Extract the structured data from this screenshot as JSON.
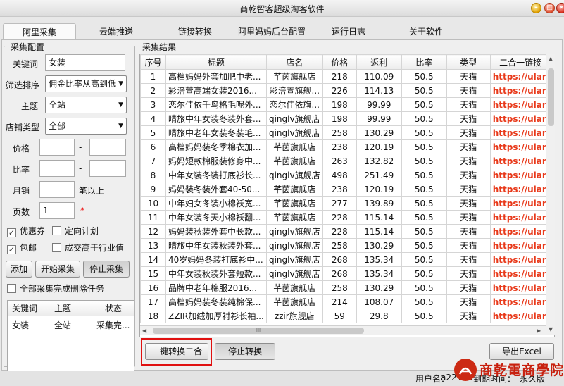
{
  "window": {
    "title": "商乾智客超级淘客软件"
  },
  "tabs": [
    "阿里采集",
    "云端推送",
    "链接转换",
    "阿里妈妈后台配置",
    "运行日志",
    "关于软件"
  ],
  "config": {
    "group_title": "采集配置",
    "keyword_label": "关键词",
    "keyword_value": "女装",
    "sort_label": "筛选排序",
    "sort_value": "佣金比率从高到低",
    "topic_label": "主题",
    "topic_value": "全站",
    "shop_type_label": "店铺类型",
    "shop_type_value": "全部",
    "price_label": "价格",
    "rate_label": "比率",
    "dash": "-",
    "monthly_sales_label": "月销",
    "monthly_sales_suffix": "笔以上",
    "pages_label": "页数",
    "pages_value": "1",
    "required_mark": "*",
    "coupon_label": "优惠券",
    "directed_plan_label": "定向计划",
    "free_shipping_label": "包邮",
    "above_industry_label": "成交高于行业值",
    "check_mark": "✓",
    "add_button": "添加",
    "start_button": "开始采集",
    "stop_button": "停止采集",
    "delete_after_label": "全部采集完成删除任务",
    "task_columns": [
      "关键词",
      "主题",
      "状态"
    ],
    "task_row": [
      "女装",
      "全站",
      "采集完..."
    ]
  },
  "results": {
    "group_title": "采集结果",
    "columns": [
      "序号",
      "标题",
      "店名",
      "价格",
      "返利",
      "比率",
      "类型",
      "二合一链接"
    ],
    "rows": [
      [
        "1",
        "高档妈妈外套加肥中老...",
        "芊茵旗舰店",
        "218",
        "110.09",
        "50.5",
        "天猫",
        "https://ulan"
      ],
      [
        "2",
        "彩涪萱高端女装2016...",
        "彩涪萱旗舰...",
        "226",
        "114.13",
        "50.5",
        "天猫",
        "https://ulan"
      ],
      [
        "3",
        "恋尔佳依千鸟格毛呢外...",
        "恋尔佳依旗...",
        "198",
        "99.99",
        "50.5",
        "天猫",
        "https://ulan"
      ],
      [
        "4",
        "晴旅中年女装冬装外套...",
        "qinglv旗舰店",
        "198",
        "99.99",
        "50.5",
        "天猫",
        "https://ulan"
      ],
      [
        "5",
        "晴旅中老年女装冬装毛...",
        "qinglv旗舰店",
        "258",
        "130.29",
        "50.5",
        "天猫",
        "https://ulan"
      ],
      [
        "6",
        "高档妈妈装冬季棉衣加...",
        "芊茵旗舰店",
        "238",
        "120.19",
        "50.5",
        "天猫",
        "https://ulan"
      ],
      [
        "7",
        "妈妈短款棉服装修身中...",
        "芊茵旗舰店",
        "263",
        "132.82",
        "50.5",
        "天猫",
        "https://ulan"
      ],
      [
        "8",
        "中年女装冬装打底衫长...",
        "qinglv旗舰店",
        "498",
        "251.49",
        "50.5",
        "天猫",
        "https://ulan"
      ],
      [
        "9",
        "妈妈装冬装外套40-50...",
        "芊茵旗舰店",
        "238",
        "120.19",
        "50.5",
        "天猫",
        "https://ulan"
      ],
      [
        "10",
        "中年妇女冬装小棉袄宽...",
        "芊茵旗舰店",
        "277",
        "139.89",
        "50.5",
        "天猫",
        "https://ulan"
      ],
      [
        "11",
        "中年女装冬天小棉袄翻...",
        "芊茵旗舰店",
        "228",
        "115.14",
        "50.5",
        "天猫",
        "https://ulan"
      ],
      [
        "12",
        "妈妈装秋装外套中长款...",
        "qinglv旗舰店",
        "228",
        "115.14",
        "50.5",
        "天猫",
        "https://ulan"
      ],
      [
        "13",
        "晴旅中年女装秋装外套...",
        "qinglv旗舰店",
        "258",
        "130.29",
        "50.5",
        "天猫",
        "https://ulan"
      ],
      [
        "14",
        "40岁妈妈冬装打底衫中...",
        "qinglv旗舰店",
        "268",
        "135.34",
        "50.5",
        "天猫",
        "https://ulan"
      ],
      [
        "15",
        "中年女装秋装外套短款...",
        "qinglv旗舰店",
        "268",
        "135.34",
        "50.5",
        "天猫",
        "https://ulan"
      ],
      [
        "16",
        "品牌中老年棉服2016...",
        "芊茵旗舰店",
        "258",
        "130.29",
        "50.5",
        "天猫",
        "https://ulan"
      ],
      [
        "17",
        "高档妈妈装冬装纯棉保...",
        "芊茵旗舰店",
        "214",
        "108.07",
        "50.5",
        "天猫",
        "https://ulan"
      ],
      [
        "18",
        "ZZIR加绒加厚衬衫长袖...",
        "zzir旗舰店",
        "59",
        "29.8",
        "50.5",
        "天猫",
        "https://ulan"
      ]
    ],
    "convert_button": "一键转换二合",
    "stop_convert_button": "停止转换",
    "export_button": "导出Excel",
    "scroll_label": "III"
  },
  "status": {
    "user_label": "用户名：",
    "user_value": "a22123",
    "expiry_label": "到期时间：",
    "expiry_value": "永久版"
  },
  "logo": {
    "text": "商乾電商學院"
  },
  "colors": {
    "link": "#e8391a",
    "highlight": "#e01010",
    "logo": "#c8200e"
  }
}
